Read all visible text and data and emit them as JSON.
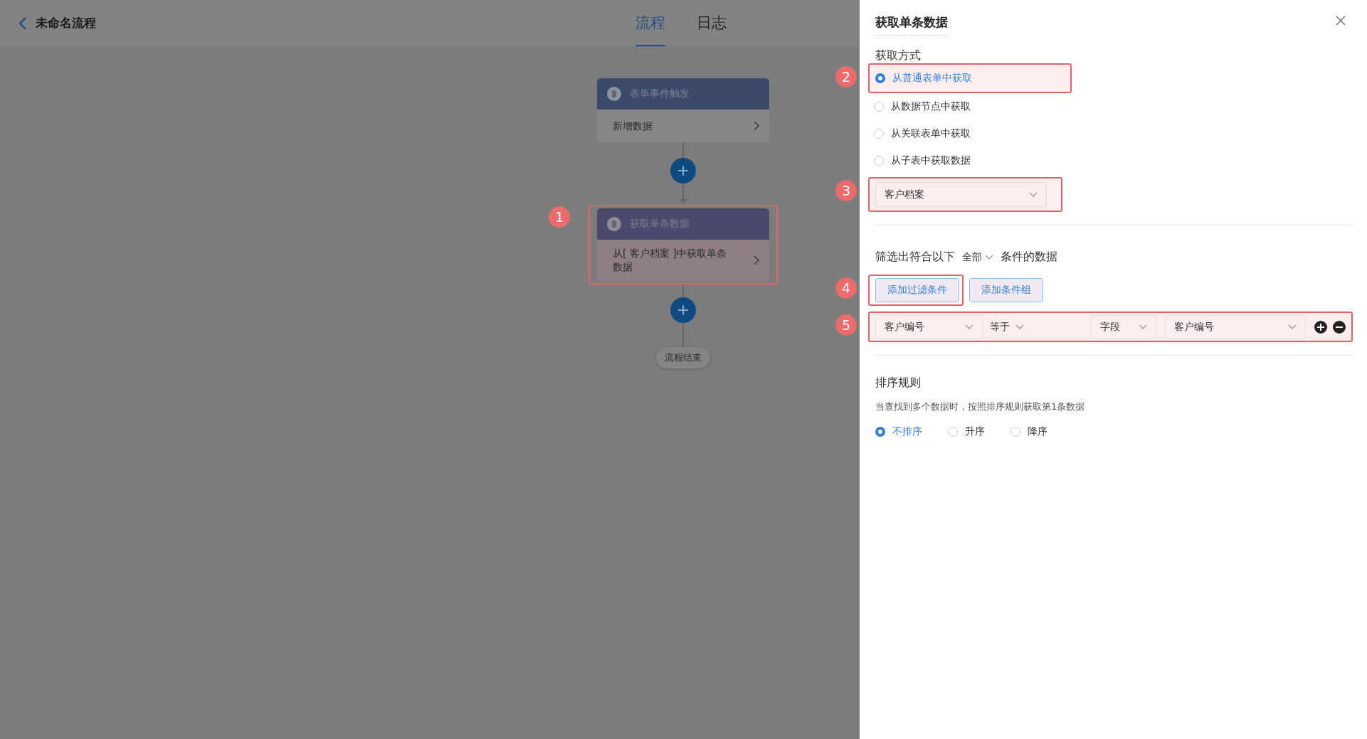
{
  "header": {
    "title": "未命名流程"
  },
  "tabs": [
    {
      "label": "流程",
      "selected": true
    },
    {
      "label": "日志",
      "selected": false
    }
  ],
  "flow": {
    "nodes": [
      {
        "title": "表单事件触发",
        "body": "新增数据"
      },
      {
        "title": "获取单条数据",
        "body": "从[ 客户档案 ]中获取单条数据",
        "callout": "1"
      }
    ],
    "end": "流程结束"
  },
  "panel": {
    "title": "获取单条数据",
    "method_label": "获取方式",
    "methods": [
      {
        "label": "从普通表单中获取",
        "selected": true,
        "callout": "2"
      },
      {
        "label": "从数据节点中获取",
        "selected": false
      },
      {
        "label": "从关联表单中获取",
        "selected": false
      },
      {
        "label": "从子表中获取数据",
        "selected": false
      }
    ],
    "form_select": {
      "value": "客户档案",
      "callout": "3"
    },
    "filter": {
      "prefix": "筛选出符合以下",
      "match": "全部",
      "suffix": "条件的数据"
    },
    "buttons": [
      {
        "label": "添加过滤条件",
        "callout": "4"
      },
      {
        "label": "添加条件组"
      }
    ],
    "condition": {
      "callout": "5",
      "field": "客户编号",
      "operator": "等于",
      "value_type": "字段",
      "value": "客户编号"
    },
    "sort": {
      "title": "排序规则",
      "hint": "当查找到多个数据时，按照排序规则获取第1条数据",
      "options": [
        {
          "label": "不排序",
          "selected": true
        },
        {
          "label": "升序",
          "selected": false
        },
        {
          "label": "降序",
          "selected": false
        }
      ]
    }
  }
}
